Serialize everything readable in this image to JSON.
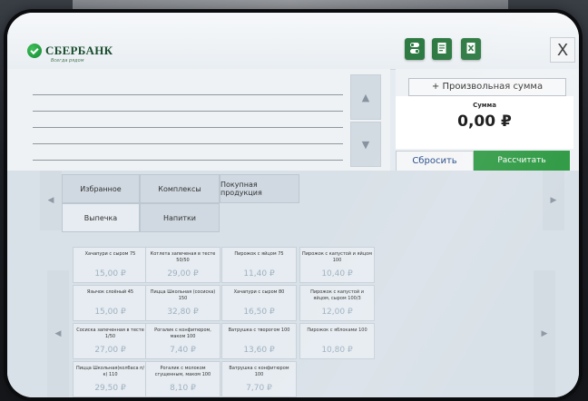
{
  "header": {
    "bank_name": "СБЕРБАНК",
    "bank_slogan": "Всегда рядом",
    "buttons": [
      {
        "icon": "toggle-settings-icon"
      },
      {
        "icon": "document-icon"
      },
      {
        "icon": "excel-icon"
      }
    ],
    "close_label": "X"
  },
  "receipt": {
    "scroll_up": "▲",
    "scroll_down": "▼"
  },
  "payment": {
    "free_amount_label": "+ Произвольная сумма",
    "sum_label": "Сумма",
    "sum_value": "0,00 ₽",
    "reset_label": "Сбросить",
    "calculate_label": "Рассчитать"
  },
  "catalog": {
    "nav_left": "◀",
    "nav_right": "▶",
    "categories": [
      "Избранное",
      "Комплексы",
      "Покупная продукция",
      "Выпечка",
      "Напитки"
    ],
    "products": [
      {
        "name": "Хачапури с сыром 75",
        "price": "15,00 ₽"
      },
      {
        "name": "Котлета запеченая в тесте 50/50",
        "price": "29,00 ₽"
      },
      {
        "name": "Пирожок с яйцом 75",
        "price": "11,40 ₽"
      },
      {
        "name": "Пирожок с капустой и яйцом 100",
        "price": "10,40 ₽"
      },
      {
        "name": "Язычок слоёный 45",
        "price": "15,00 ₽"
      },
      {
        "name": "Пицца Школьная (сосиска) 150",
        "price": "32,80 ₽"
      },
      {
        "name": "Хачапури с сыром 80",
        "price": "16,50 ₽"
      },
      {
        "name": "Пирожок с капустой и яйцом, сыром 100/3",
        "price": "12,00 ₽"
      },
      {
        "name": "Сосиска запеченная в тесте 1/50",
        "price": "27,00 ₽"
      },
      {
        "name": "Рогалик с конфитюром, маком 100",
        "price": "7,40 ₽"
      },
      {
        "name": "Ватрушка с творогом 100",
        "price": "13,60 ₽"
      },
      {
        "name": "Пирожок с яблоками 100",
        "price": "10,80 ₽"
      },
      {
        "name": "Пицца Школьная(колбаса п/к) 110",
        "price": "29,50 ₽"
      },
      {
        "name": "Рогалик с молоком сгущенным, маком 100",
        "price": "8,10 ₽"
      },
      {
        "name": "Ватрушка с конфитюром 100",
        "price": "7,70 ₽"
      }
    ]
  }
}
